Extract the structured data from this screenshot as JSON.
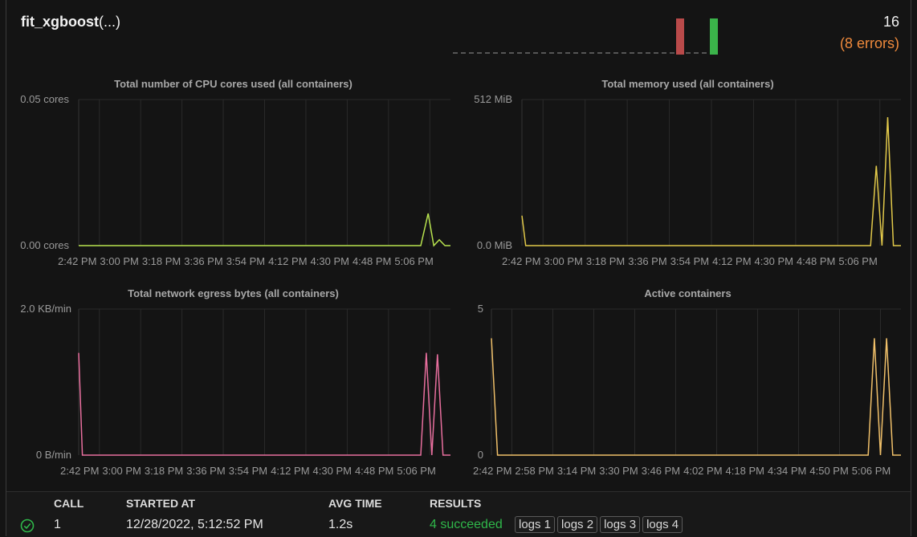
{
  "header": {
    "function_name": "fit_xgboost",
    "function_args": "(...)",
    "total_calls": "16",
    "errors_text": "(8 errors)"
  },
  "colors": {
    "cpu": "#b8e34f",
    "memory": "#e2c94a",
    "network": "#e86f9e",
    "containers": "#f0c06a",
    "error_bar": "#b94a4a",
    "success_bar": "#3bb34a",
    "success_text": "#2fb84a",
    "errors_text": "#f08a3c"
  },
  "charts": {
    "cpu": {
      "title": "Total number of CPU cores used (all containers)",
      "ymax_label": "0.05 cores",
      "ymin_label": "0.00 cores",
      "xticks": [
        "2:42 PM",
        "3:00 PM",
        "3:18 PM",
        "3:36 PM",
        "3:54 PM",
        "4:12 PM",
        "4:30 PM",
        "4:48 PM",
        "5:06 PM"
      ]
    },
    "memory": {
      "title": "Total memory used (all containers)",
      "ymax_label": "512 MiB",
      "ymin_label": "0.0 MiB",
      "xticks": [
        "2:42 PM",
        "3:00 PM",
        "3:18 PM",
        "3:36 PM",
        "3:54 PM",
        "4:12 PM",
        "4:30 PM",
        "4:48 PM",
        "5:06 PM"
      ]
    },
    "network": {
      "title": "Total network egress bytes (all containers)",
      "ymax_label": "2.0 KB/min",
      "ymin_label": "0 B/min",
      "xticks": [
        "2:42 PM",
        "3:00 PM",
        "3:18 PM",
        "3:36 PM",
        "3:54 PM",
        "4:12 PM",
        "4:30 PM",
        "4:48 PM",
        "5:06 PM"
      ]
    },
    "containers": {
      "title": "Active containers",
      "ymax_label": "5",
      "ymin_label": "0",
      "xticks": [
        "2:42 PM",
        "2:58 PM",
        "3:14 PM",
        "3:30 PM",
        "3:46 PM",
        "4:02 PM",
        "4:18 PM",
        "4:34 PM",
        "4:50 PM",
        "5:06 PM"
      ]
    }
  },
  "chart_data": [
    {
      "type": "line",
      "title": "Total number of CPU cores used (all containers)",
      "ylim": [
        0,
        0.05
      ],
      "series": [
        {
          "x": [
            0,
            0.92,
            0.94,
            0.955,
            0.97,
            0.985,
            1.0
          ],
          "values": [
            0,
            0,
            0.011,
            0,
            0.002,
            0,
            0
          ]
        }
      ]
    },
    {
      "type": "line",
      "title": "Total memory used (all containers)",
      "ylim": [
        0,
        512
      ],
      "series": [
        {
          "x": [
            0,
            0.01,
            0.92,
            0.935,
            0.95,
            0.965,
            0.98,
            1.0
          ],
          "values": [
            105,
            0,
            0,
            280,
            0,
            450,
            0,
            0
          ]
        }
      ]
    },
    {
      "type": "line",
      "title": "Total network egress bytes (all containers)",
      "ylim": [
        0,
        2.0
      ],
      "series": [
        {
          "x": [
            0,
            0.01,
            0.92,
            0.935,
            0.95,
            0.965,
            0.98,
            1.0
          ],
          "values": [
            1.4,
            0,
            0,
            1.4,
            0,
            1.38,
            0,
            0
          ]
        }
      ]
    },
    {
      "type": "line",
      "title": "Active containers",
      "ylim": [
        0,
        5
      ],
      "series": [
        {
          "x": [
            0,
            0.015,
            0.92,
            0.935,
            0.95,
            0.965,
            0.98,
            1.0
          ],
          "values": [
            4,
            0,
            0,
            4,
            0,
            4,
            0,
            0
          ]
        }
      ]
    }
  ],
  "table": {
    "columns": [
      "CALL",
      "STARTED AT",
      "AVG TIME",
      "RESULTS"
    ],
    "rows": [
      {
        "call": "1",
        "started_at": "12/28/2022, 5:12:52 PM",
        "avg_time": "1.2s",
        "results": "4 succeeded",
        "logs": [
          "logs 1",
          "logs 2",
          "logs 3",
          "logs 4"
        ]
      }
    ]
  }
}
